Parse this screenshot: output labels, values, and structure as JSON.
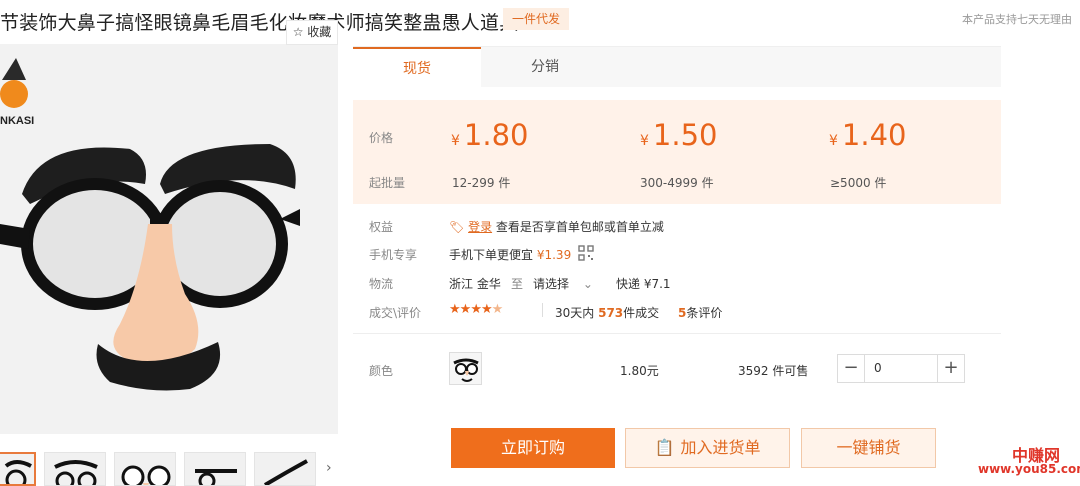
{
  "product": {
    "title": "节装饰大鼻子搞怪眼镜鼻毛眉毛化妆魔术师搞笑整蛊愚人道具",
    "badge": "一件代发",
    "notice": "本产品支持七天无理由",
    "favorite_label": "收藏",
    "image_brand": "NKASI"
  },
  "tabs": [
    {
      "label": "现货",
      "active": true
    },
    {
      "label": "分销",
      "active": false
    }
  ],
  "pricing": {
    "price_label": "价格",
    "qty_label": "起批量",
    "currency": "¥",
    "tiers": [
      {
        "price": "1.80",
        "qty": "12-299 件"
      },
      {
        "price": "1.50",
        "qty": "300-4999 件"
      },
      {
        "price": "1.40",
        "qty": "≥5000 件"
      }
    ]
  },
  "benefits": {
    "label": "权益",
    "link": "登录",
    "text": "查看是否享首单包邮或首单立减"
  },
  "mobile": {
    "label": "手机专享",
    "text": "手机下单更便宜",
    "price": "¥1.39"
  },
  "shipping": {
    "label": "物流",
    "origin": "浙江 金华",
    "to": "至",
    "destination": "请选择",
    "fee": "快递 ¥7.1"
  },
  "reviews": {
    "label": "成交\\评价",
    "rating": 4.5,
    "sales_prefix": "30天内",
    "sales_count": "573",
    "sales_suffix": "件成交",
    "review_count": "5",
    "review_suffix": "条评价"
  },
  "variant": {
    "label": "颜色",
    "price": "1.80元",
    "stock": "3592 件可售",
    "quantity": "0"
  },
  "actions": {
    "buy": "立即订购",
    "cart": "加入进货单",
    "list": "一键铺货"
  },
  "watermark": {
    "name": "中赚网",
    "url": "www.you85.com"
  },
  "colors": {
    "accent": "#e06a21",
    "buy_button": "#ef6e1c",
    "price_panel_bg": "#fff2e9"
  }
}
